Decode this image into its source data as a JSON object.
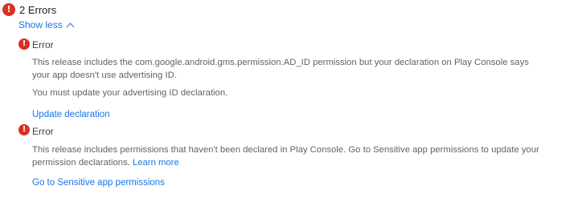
{
  "header": {
    "title": "2 Errors",
    "toggle_label": "Show less"
  },
  "errors": [
    {
      "label": "Error",
      "message_1": "This release includes the com.google.android.gms.permission.AD_ID permission but your declaration on Play Console says your app doesn't use advertising ID.",
      "message_2": "You must update your advertising ID declaration.",
      "action_label": "Update declaration"
    },
    {
      "label": "Error",
      "message_1": "This release includes permissions that haven't been declared in Play Console. Go to Sensitive app permissions to update your permission declarations.",
      "inline_link": "Learn more",
      "action_label": "Go to Sensitive app permissions"
    }
  ],
  "colors": {
    "error": "#d93025",
    "link": "#1a73e8",
    "text": "#202124",
    "muted": "#5f6368"
  }
}
